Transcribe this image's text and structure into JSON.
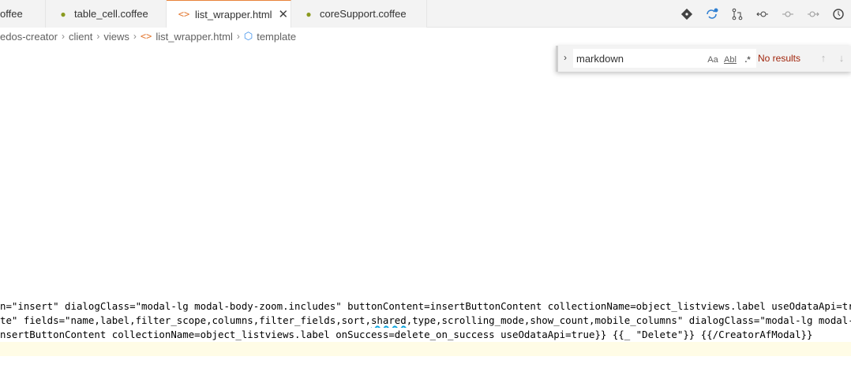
{
  "tabs": [
    {
      "label": "offee",
      "icon": "coffee-icon",
      "active": false
    },
    {
      "label": "table_cell.coffee",
      "icon": "coffee-icon",
      "active": false
    },
    {
      "label": "list_wrapper.html",
      "icon": "html-icon",
      "active": true
    },
    {
      "label": "coreSupport.coffee",
      "icon": "coffee-icon",
      "active": false
    }
  ],
  "actions": [
    {
      "name": "git-icon",
      "glyph": "◆"
    },
    {
      "name": "sync-icon",
      "glyph": "⟳"
    },
    {
      "name": "pull-request-icon",
      "glyph": "⇄"
    },
    {
      "name": "go-back-icon",
      "glyph": "⟲"
    },
    {
      "name": "commit-icon",
      "glyph": "-○-"
    },
    {
      "name": "go-forward-icon",
      "glyph": "⟳"
    },
    {
      "name": "timeline-icon",
      "glyph": "◷"
    }
  ],
  "breadcrumb": {
    "items": [
      "edos-creator",
      "client",
      "views",
      "list_wrapper.html",
      "template"
    ]
  },
  "find": {
    "value": "markdown",
    "match_case": "Aa",
    "whole_word": "Abl",
    "regex": ".*",
    "status": "No results",
    "prev": "↑",
    "next": "↓"
  },
  "code": {
    "line1": "n=\"insert\" dialogClass=\"modal-lg modal-body-zoom.includes\" buttonContent=insertButtonContent collectionName=object_listviews.label useOdataApi=true}}",
    "line2_before": "te\" fields=\"name,label,filter_scope,columns,filter_fields,sort,",
    "line2_squiggle": "shared",
    "line2_after": ",type,scrolling_mode,show_count,mobile_columns\" dialogClass=\"modal-lg modal-body-",
    "line3": "nsertButtonContent collectionName=object_listviews.label onSuccess=delete_on_success useOdataApi=true}} {{_ \"Delete\"}} {{/CreatorAfModal}}"
  },
  "colors": {
    "accent": "#e8833a",
    "no_results": "#a1260d",
    "squiggle": "#0aa5e0",
    "current_line": "#fffce6"
  }
}
